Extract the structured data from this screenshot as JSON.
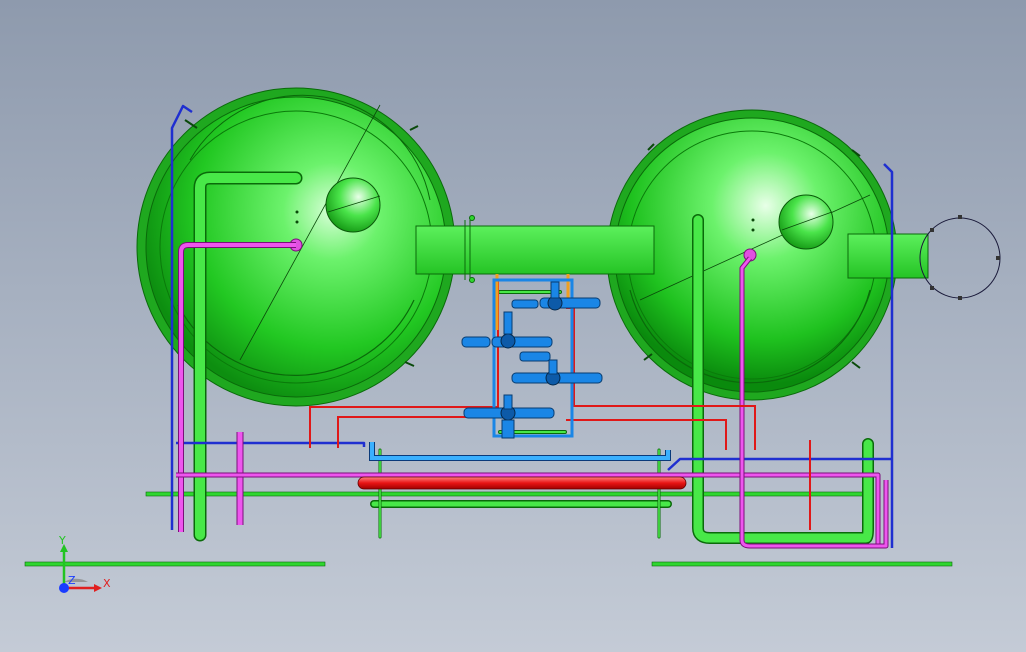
{
  "triad": {
    "x_label": "X",
    "y_label": "Y",
    "z_label": "Z",
    "x_color": "#e02020",
    "y_color": "#22c422",
    "z_color": "#1a3cff"
  },
  "colors": {
    "vessel_green": "#2fd62f",
    "vessel_dark": "#0f8a12",
    "pipe_green": "#35e035",
    "pipe_magenta": "#e040e0",
    "pipe_blue": "#1f2fd0",
    "pipe_red": "#e01818",
    "pipe_cyan": "#2aa0ff",
    "valve_blue": "#1a86e6",
    "pipe_orange": "#f0a020",
    "background_top": "#8e9aad",
    "background_bottom": "#c4cbd6"
  }
}
